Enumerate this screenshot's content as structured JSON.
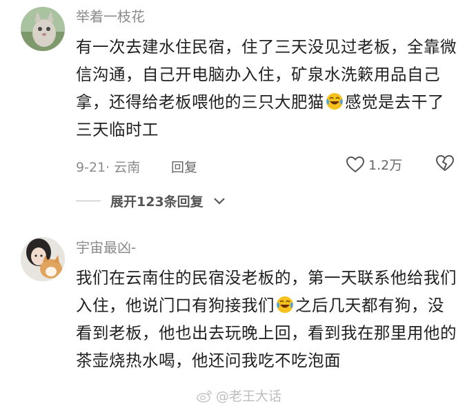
{
  "comments": [
    {
      "username": "举着一枝花",
      "text_parts": [
        "有一次去建水住民宿，住了三天没见过老板，全靠微信沟通，自己开电脑办入住，矿泉水洗簌用品自己拿，还得给老板喂他的三只大肥猫",
        "感觉是去干了三天临时工"
      ],
      "emoji": "crying-laughing-emoji",
      "date_location": "9-21· 云南",
      "reply_label": "回复",
      "like_count": "1.2万",
      "expand_label": "展开123条回复"
    },
    {
      "username": "宇宙最凶-",
      "text_parts": [
        "我们在云南住的民宿没老板的，第一天联系他给我们入住，他说门口有狗接我们",
        "之后几天都有狗，没看到老板，他也出去玩晚上回，看到我在那里用他的茶壶烧热水喝，他还问我吃不吃泡面"
      ],
      "emoji": "crying-laughing-emoji"
    }
  ],
  "watermark": "@老王大话",
  "colors": {
    "meta": "#8a8a8a",
    "text": "#1f1f1f",
    "emoji_face": "#f7c21e",
    "emoji_tears": "#4aa3e8"
  }
}
